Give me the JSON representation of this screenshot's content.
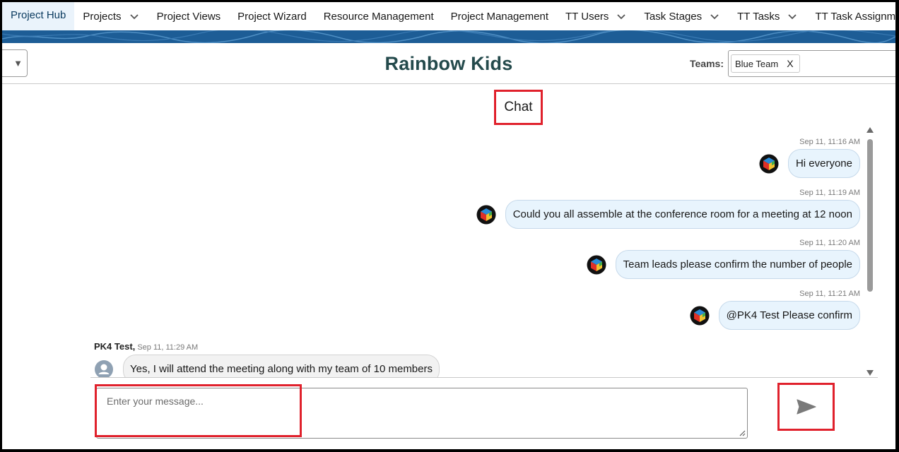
{
  "nav": {
    "items": [
      {
        "label": "Project Hub",
        "active": true,
        "dropdown": false
      },
      {
        "label": "Projects",
        "active": false,
        "dropdown": true
      },
      {
        "label": "Project Views",
        "active": false,
        "dropdown": false
      },
      {
        "label": "Project Wizard",
        "active": false,
        "dropdown": false
      },
      {
        "label": "Resource Management",
        "active": false,
        "dropdown": false
      },
      {
        "label": "Project Management",
        "active": false,
        "dropdown": false
      },
      {
        "label": "TT Users",
        "active": false,
        "dropdown": true
      },
      {
        "label": "Task Stages",
        "active": false,
        "dropdown": true
      },
      {
        "label": "TT Tasks",
        "active": false,
        "dropdown": true
      },
      {
        "label": "TT Task Assignments",
        "active": false,
        "dropdown": false
      }
    ]
  },
  "header": {
    "title": "Rainbow Kids",
    "teams_label": "Teams:",
    "team_pill": "Blue Team",
    "team_pill_remove": "X",
    "left_select_arrow": "▼"
  },
  "chat": {
    "title": "Chat",
    "messages": [
      {
        "direction": "out",
        "time": "Sep 11, 11:16 AM",
        "text": "Hi everyone"
      },
      {
        "direction": "out",
        "time": "Sep 11, 11:19 AM",
        "text": "Could you all assemble at the conference room for a meeting at 12 noon"
      },
      {
        "direction": "out",
        "time": "Sep 11, 11:20 AM",
        "text": "Team leads please confirm the number of people"
      },
      {
        "direction": "out",
        "time": "Sep 11, 11:21 AM",
        "text": "@PK4 Test Please confirm"
      }
    ],
    "incoming": {
      "author": "PK4 Test,",
      "time": "Sep 11, 11:29 AM",
      "text": "Yes, I will attend the meeting along with my team of 10 members"
    }
  },
  "composer": {
    "placeholder": "Enter your message...",
    "value": ""
  },
  "icons": {
    "nav_dropdown": "chevron-down-icon",
    "sender_avatar": "cube-logo-icon",
    "user_avatar": "user-icon",
    "send": "send-icon",
    "scroll_up": "triangle-up-icon",
    "scroll_down": "triangle-down-icon"
  },
  "colors": {
    "title": "#244a4c",
    "highlight": "#e0212c",
    "band": "#1d5d96",
    "bubble_out": "#e8f4fd",
    "bubble_in": "#f2f2f2"
  }
}
